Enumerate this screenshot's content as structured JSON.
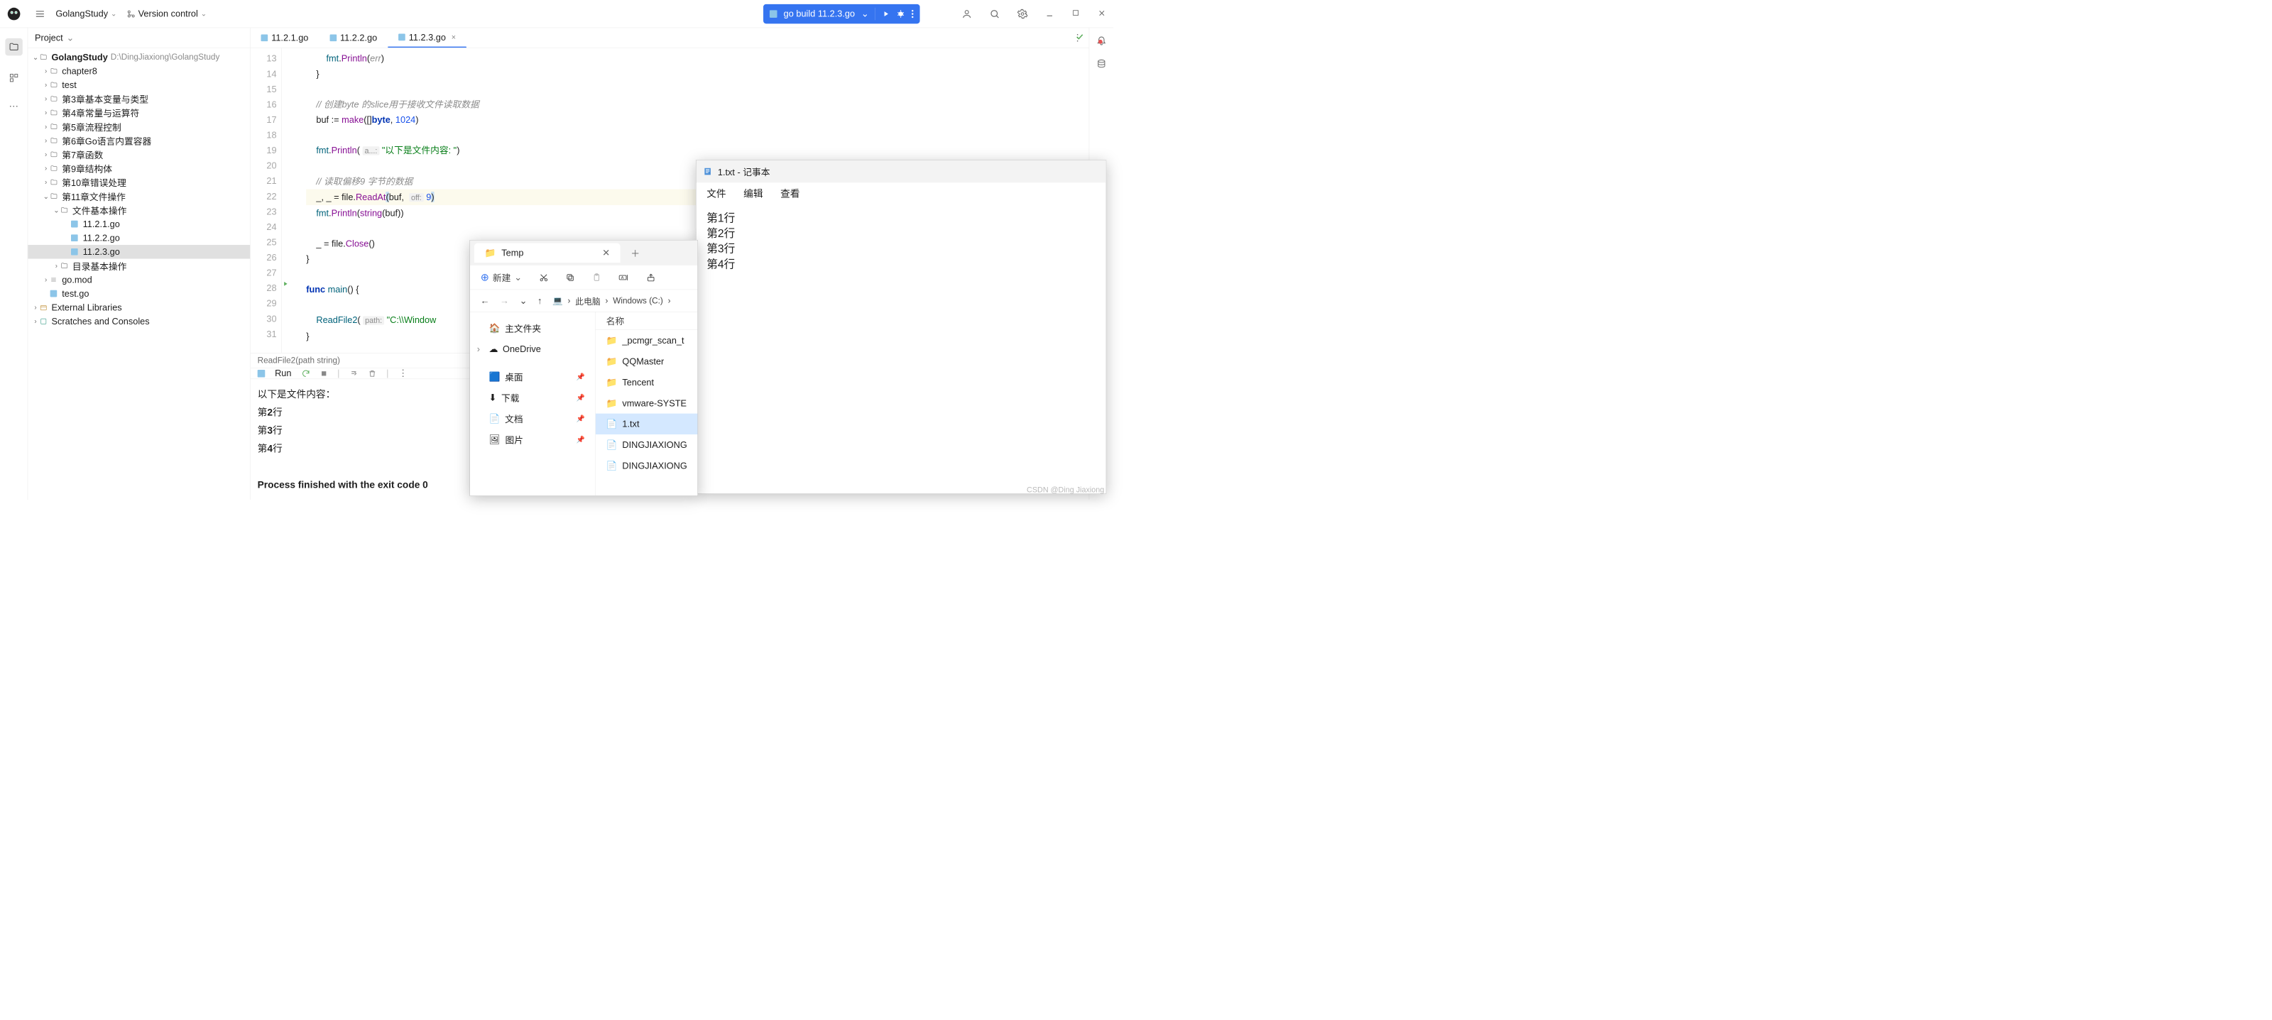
{
  "top": {
    "project_name": "GolangStudy",
    "vcs_label": "Version control",
    "run_config": "go build 11.2.3.go"
  },
  "project": {
    "panel_title": "Project",
    "root": "GolangStudy",
    "root_path": "D:\\DingJiaxiong\\GolangStudy",
    "items": [
      "chapter8",
      "test",
      "第3章基本变量与类型",
      "第4章常量与运算符",
      "第5章流程控制",
      "第6章Go语言内置容器",
      "第7章函数",
      "第9章结构体",
      "第10章错误处理",
      "第11章文件操作"
    ],
    "ch11_sub": "文件基本操作",
    "ch11_files": [
      "11.2.1.go",
      "11.2.2.go",
      "11.2.3.go"
    ],
    "ch11_dir2": "目录基本操作",
    "root_files": [
      "go.mod",
      "test.go"
    ],
    "ext_lib": "External Libraries",
    "scratches": "Scratches and Consoles"
  },
  "tabs": [
    "11.2.1.go",
    "11.2.2.go",
    "11.2.3.go"
  ],
  "code": {
    "lines": [
      {
        "n": 13,
        "html": "        <span class='fn'>fmt</span>.<span class='fn2'>Println</span>(<span class='cmt'>err</span>)"
      },
      {
        "n": 14,
        "html": "    }"
      },
      {
        "n": 15,
        "html": ""
      },
      {
        "n": 16,
        "html": "    <span class='cmt'>// 创建byte 的slice用于接收文件读取数据</span>"
      },
      {
        "n": 17,
        "html": "    buf := <span class='fn2'>make</span>([]<span class='kw'>byte</span>, <span class='num'>1024</span>)"
      },
      {
        "n": 18,
        "html": ""
      },
      {
        "n": 19,
        "html": "    <span class='fn'>fmt</span>.<span class='fn2'>Println</span>( <span class='hint'>a...:</span> <span class='str'>\"以下是文件内容: \"</span>)"
      },
      {
        "n": 20,
        "html": ""
      },
      {
        "n": 21,
        "html": "    <span class='cmt'>// 读取偏移9 字节的数据</span>"
      },
      {
        "n": 22,
        "html": "<span class='hl-line'>    _, _ = file.<span class='fn2'>ReadAt</span><span class='caret-paren'>(</span>buf,  <span class='hint'>off:</span> <span class='num'>9</span><span class='caret-paren'>)</span></span>"
      },
      {
        "n": 23,
        "html": "    <span class='fn'>fmt</span>.<span class='fn2'>Println</span>(<span class='fn2'>string</span>(buf))"
      },
      {
        "n": 24,
        "html": ""
      },
      {
        "n": 25,
        "html": "    _ = file.<span class='fn2'>Close</span>()"
      },
      {
        "n": 26,
        "html": "}"
      },
      {
        "n": 27,
        "html": ""
      },
      {
        "n": 28,
        "html": "<span class='kw'>func</span> <span class='fn'>main</span>() {",
        "run": true
      },
      {
        "n": 29,
        "html": ""
      },
      {
        "n": 30,
        "html": "    <span class='fn'>ReadFile2</span>( <span class='hint'>path:</span> <span class='str'>\"C:\\\\Window</span>"
      },
      {
        "n": 31,
        "html": "}"
      }
    ],
    "breadcrumb": "ReadFile2(path string)"
  },
  "run": {
    "label": "Run",
    "output": [
      "以下是文件内容：",
      "第2行",
      "第3行",
      "第4行",
      "",
      "Process finished with the exit code 0"
    ]
  },
  "notepad": {
    "title": "1.txt - 记事本",
    "menus": [
      "文件",
      "编辑",
      "查看"
    ],
    "lines": [
      "第1行",
      "第2行",
      "第3行",
      "第4行"
    ]
  },
  "explorer": {
    "tab": "Temp",
    "new_label": "新建",
    "path": [
      "此电脑",
      "Windows (C:)"
    ],
    "side": [
      {
        "label": "主文件夹",
        "icon": "🏠"
      },
      {
        "label": "OneDrive",
        "icon": "☁",
        "expandable": true
      },
      {
        "label": "",
        "spacer": true
      },
      {
        "label": "桌面",
        "icon": "🟦",
        "pin": true
      },
      {
        "label": "下载",
        "icon": "⬇",
        "pin": true
      },
      {
        "label": "文档",
        "icon": "📄",
        "pin": true
      },
      {
        "label": "图片",
        "icon": "🖼",
        "pin": true
      }
    ],
    "col_name": "名称",
    "files": [
      {
        "name": "_pcmgr_scan_t",
        "folder": true
      },
      {
        "name": "QQMaster",
        "folder": true
      },
      {
        "name": "Tencent",
        "folder": true
      },
      {
        "name": "vmware-SYSTE",
        "folder": true
      },
      {
        "name": "1.txt",
        "folder": false,
        "selected": true
      },
      {
        "name": "DINGJIAXIONG",
        "folder": false
      },
      {
        "name": "DINGJIAXIONG",
        "folder": false
      }
    ]
  },
  "watermark": "CSDN @Ding Jiaxiong"
}
